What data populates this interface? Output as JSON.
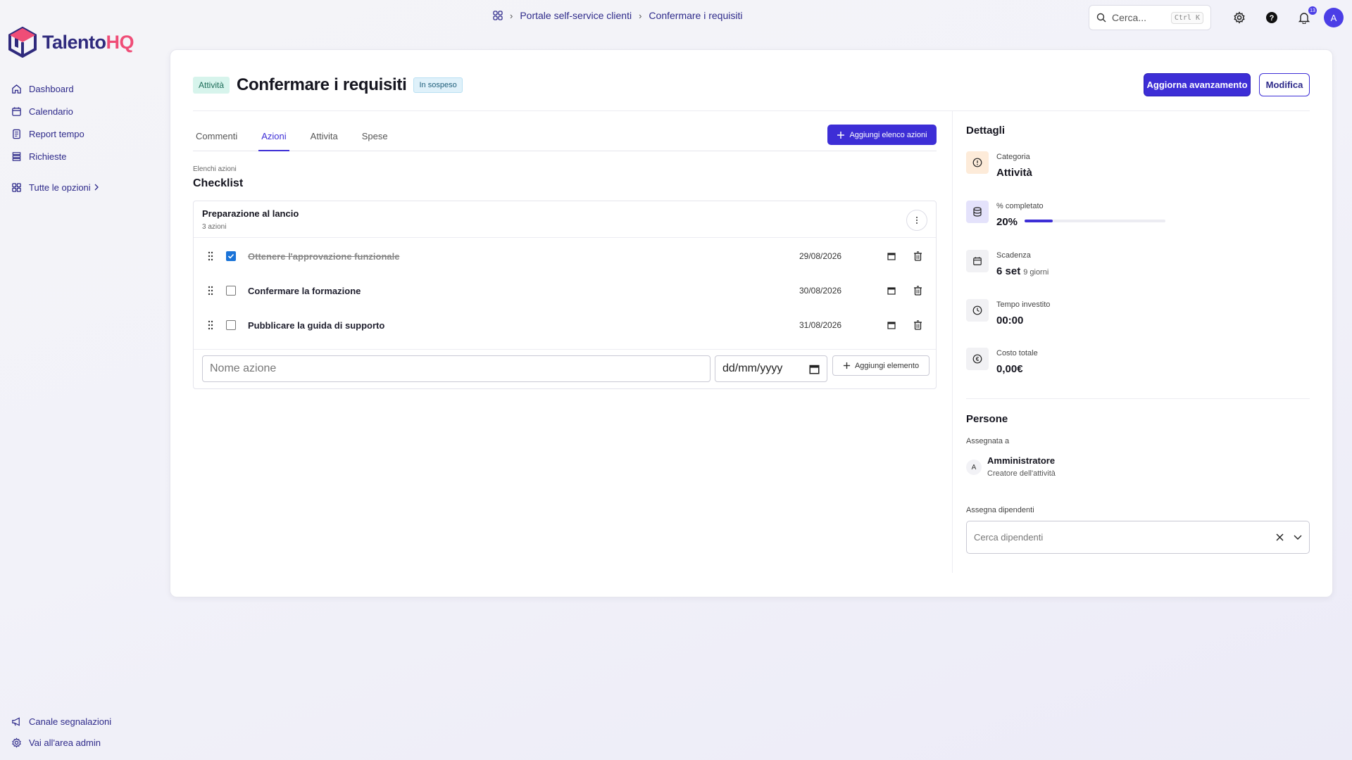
{
  "brand": {
    "name_part1": "Talento",
    "name_part2": "HQ"
  },
  "sidebar": {
    "items": [
      {
        "label": "Dashboard",
        "icon": "home-icon"
      },
      {
        "label": "Calendario",
        "icon": "calendar-icon"
      },
      {
        "label": "Report tempo",
        "icon": "report-icon"
      },
      {
        "label": "Richieste",
        "icon": "list-icon"
      }
    ],
    "all_options": "Tutte le opzioni",
    "bottom": [
      {
        "label": "Canale segnalazioni",
        "icon": "megaphone-icon"
      },
      {
        "label": "Vai all'area admin",
        "icon": "gear-icon"
      }
    ]
  },
  "breadcrumb": [
    "Portale self-service clienti",
    "Confermare i requisiti"
  ],
  "search": {
    "placeholder": "Cerca...",
    "shortcut": "Ctrl K"
  },
  "notifications": {
    "count": "13"
  },
  "user": {
    "initial": "A"
  },
  "task": {
    "type_chip": "Attività",
    "title": "Confermare i requisiti",
    "status": "In sospeso",
    "update_button": "Aggiorna avanzamento",
    "edit_button": "Modifica"
  },
  "tabs": [
    {
      "label": "Commenti",
      "active": false
    },
    {
      "label": "Azioni",
      "active": true
    },
    {
      "label": "Attivita",
      "active": false
    },
    {
      "label": "Spese",
      "active": false
    }
  ],
  "add_list_button": "Aggiungi elenco azioni",
  "section": {
    "small": "Elenchi azioni",
    "title": "Checklist"
  },
  "checklist": {
    "title": "Preparazione al lancio",
    "count": "3 azioni",
    "items": [
      {
        "label": "Ottenere l'approvazione funzionale",
        "date": "29/08/2026",
        "done": true
      },
      {
        "label": "Confermare la formazione",
        "date": "30/08/2026",
        "done": false
      },
      {
        "label": "Pubblicare la guida di supporto",
        "date": "31/08/2026",
        "done": false
      }
    ],
    "new_item_placeholder": "Nome azione",
    "date_placeholder": "dd/mm/yyyy",
    "add_item_button": "Aggiungi elemento"
  },
  "details": {
    "title": "Dettagli",
    "category_label": "Categoria",
    "category_value": "Attività",
    "progress_label": "% completato",
    "progress_value": "20%",
    "progress_fraction": 0.2,
    "due_label": "Scadenza",
    "due_value": "6 set",
    "due_sub": "9 giorni",
    "time_label": "Tempo investito",
    "time_value": "00:00",
    "cost_label": "Costo totale",
    "cost_value": "0,00€"
  },
  "people": {
    "title": "Persone",
    "assigned_label": "Assegnata a",
    "assignee_initial": "A",
    "assignee_name": "Amministratore",
    "assignee_role": "Creatore dell'attività",
    "assign_label": "Assegna dipendenti",
    "assign_placeholder": "Cerca dipendenti"
  },
  "colors": {
    "accent": "#3d2ed6",
    "brand_dark": "#2f2a7d",
    "brand_pink": "#ef4d77",
    "chip_green": "#d7f4ec",
    "chip_blue": "#dff1fa"
  }
}
